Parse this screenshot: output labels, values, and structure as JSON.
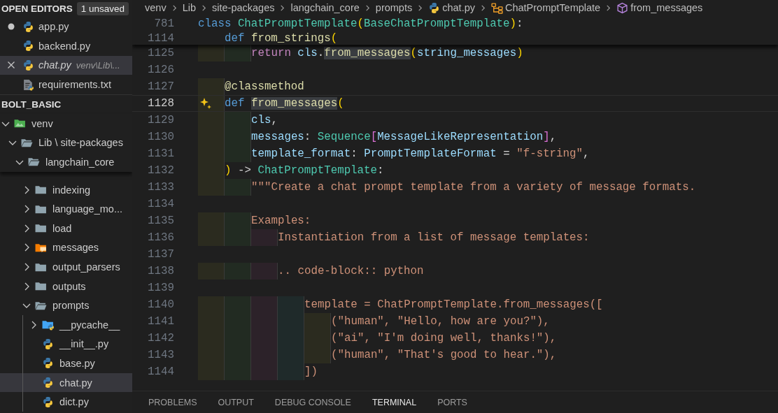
{
  "open_editors": {
    "title": "OPEN EDITORS",
    "badge": "1 unsaved",
    "items": [
      {
        "name": "app.py",
        "kind": "python",
        "dirty": true,
        "selected": false,
        "preview": false
      },
      {
        "name": "backend.py",
        "kind": "python",
        "dirty": false,
        "selected": false,
        "preview": false
      },
      {
        "name": "chat.py",
        "kind": "python",
        "dirty": false,
        "selected": true,
        "preview": true,
        "description": "venv\\Lib\\..."
      },
      {
        "name": "requirements.txt",
        "kind": "text",
        "dirty": false,
        "selected": false,
        "preview": false
      }
    ]
  },
  "explorer": {
    "title": "BOLT_BASIC",
    "tree": [
      {
        "name": "venv",
        "kind": "venv-folder",
        "expanded": true,
        "selected": false,
        "children": [
          {
            "name": "Lib \\ site-packages",
            "kind": "folder",
            "expanded": true,
            "selected": false,
            "children": [
              {
                "name": "langchain_core",
                "kind": "folder",
                "expanded": true,
                "selected": false,
                "children": [
                  {
                    "name": "indexing",
                    "kind": "folder",
                    "expanded": false,
                    "selected": false
                  },
                  {
                    "name": "language_mo...",
                    "kind": "folder",
                    "expanded": false,
                    "selected": false
                  },
                  {
                    "name": "load",
                    "kind": "folder",
                    "expanded": false,
                    "selected": false
                  },
                  {
                    "name": "messages",
                    "kind": "messages-folder",
                    "expanded": false,
                    "selected": false
                  },
                  {
                    "name": "output_parsers",
                    "kind": "folder",
                    "expanded": false,
                    "selected": false
                  },
                  {
                    "name": "outputs",
                    "kind": "folder",
                    "expanded": false,
                    "selected": false
                  },
                  {
                    "name": "prompts",
                    "kind": "folder",
                    "expanded": true,
                    "selected": false,
                    "children": [
                      {
                        "name": "__pycache__",
                        "kind": "pycache-folder",
                        "expanded": false,
                        "selected": false
                      },
                      {
                        "name": "__init__.py",
                        "kind": "python",
                        "selected": false
                      },
                      {
                        "name": "base.py",
                        "kind": "python",
                        "selected": false
                      },
                      {
                        "name": "chat.py",
                        "kind": "python",
                        "selected": true
                      },
                      {
                        "name": "dict.py",
                        "kind": "python",
                        "selected": false
                      }
                    ]
                  }
                ]
              }
            ]
          }
        ]
      }
    ]
  },
  "breadcrumb": [
    {
      "label": "venv",
      "kind": "folder"
    },
    {
      "label": "Lib",
      "kind": "folder"
    },
    {
      "label": "site-packages",
      "kind": "folder"
    },
    {
      "label": "langchain_core",
      "kind": "folder"
    },
    {
      "label": "prompts",
      "kind": "folder"
    },
    {
      "label": "chat.py",
      "kind": "python"
    },
    {
      "label": "ChatPromptTemplate",
      "kind": "class"
    },
    {
      "label": "from_messages",
      "kind": "method"
    }
  ],
  "sticky_lines": [
    {
      "num": "781",
      "tokens": [
        {
          "t": "class",
          "kind": "kw"
        },
        {
          "t": " ChatPromptTemplate",
          "kind": "type"
        },
        {
          "t": "(",
          "kind": "b1"
        },
        {
          "t": "BaseChatPromptTemplate",
          "kind": "type"
        },
        {
          "t": ")",
          "kind": "b1"
        },
        {
          "t": ":",
          "kind": "p"
        }
      ]
    },
    {
      "num": "1114",
      "tokens": [
        {
          "t": "    def",
          "kind": "kw"
        },
        {
          "t": " from_strings",
          "kind": "fn"
        },
        {
          "t": "(",
          "kind": "b1"
        }
      ]
    }
  ],
  "lines": [
    {
      "num": "1125",
      "current": false,
      "tokens": [
        {
          "t": "        return",
          "kind": "ctl",
          "highlighted": false
        },
        {
          "t": " cls",
          "kind": "var",
          "highlighted": false
        },
        {
          "t": ".",
          "kind": "p",
          "highlighted": false
        },
        {
          "t": "from_messages",
          "kind": "fn",
          "highlighted": true
        },
        {
          "t": "(",
          "kind": "b1",
          "highlighted": false
        },
        {
          "t": "string_messages",
          "kind": "var",
          "highlighted": false
        },
        {
          "t": ")",
          "kind": "b1",
          "highlighted": false
        }
      ]
    },
    {
      "num": "1126",
      "current": false
    },
    {
      "num": "1127",
      "current": false,
      "tokens": [
        {
          "t": "    @classmethod",
          "kind": "fn",
          "highlighted": false
        }
      ]
    },
    {
      "num": "1128",
      "current": true,
      "tokens": [
        {
          "t": "    def ",
          "kind": "kw",
          "highlighted": false
        },
        {
          "t": "from_messages",
          "kind": "fn",
          "highlighted": true
        },
        {
          "t": "(",
          "kind": "b1",
          "highlighted": false
        }
      ]
    },
    {
      "num": "1129",
      "current": false,
      "tokens": [
        {
          "t": "        cls",
          "kind": "var",
          "highlighted": false
        },
        {
          "t": ",",
          "kind": "p",
          "highlighted": false
        }
      ]
    },
    {
      "num": "1130",
      "current": false,
      "tokens": [
        {
          "t": "        messages",
          "kind": "var",
          "highlighted": false
        },
        {
          "t": ": ",
          "kind": "p",
          "highlighted": false
        },
        {
          "t": "Sequence",
          "kind": "type",
          "highlighted": false
        },
        {
          "t": "[",
          "kind": "b2",
          "highlighted": false
        },
        {
          "t": "MessageLikeRepresentation",
          "kind": "var",
          "highlighted": false
        },
        {
          "t": "]",
          "kind": "b2",
          "highlighted": false
        },
        {
          "t": ",",
          "kind": "p",
          "highlighted": false
        }
      ]
    },
    {
      "num": "1131",
      "current": false,
      "tokens": [
        {
          "t": "        template_format",
          "kind": "var",
          "highlighted": false
        },
        {
          "t": ": ",
          "kind": "p",
          "highlighted": false
        },
        {
          "t": "PromptTemplateFormat",
          "kind": "var",
          "highlighted": false
        },
        {
          "t": " = ",
          "kind": "p",
          "highlighted": false
        },
        {
          "t": "\"f-string\"",
          "kind": "str",
          "highlighted": false
        },
        {
          "t": ",",
          "kind": "p",
          "highlighted": false
        }
      ]
    },
    {
      "num": "1132",
      "current": false,
      "tokens": [
        {
          "t": "    )",
          "kind": "b1",
          "highlighted": false
        },
        {
          "t": " -> ",
          "kind": "p",
          "highlighted": false
        },
        {
          "t": "ChatPromptTemplate",
          "kind": "type",
          "highlighted": false
        },
        {
          "t": ":",
          "kind": "p",
          "highlighted": false
        }
      ]
    },
    {
      "num": "1133",
      "current": false,
      "tokens": [
        {
          "t": "        \"\"\"Create a chat prompt template from a variety of message formats.",
          "kind": "str",
          "highlighted": false
        }
      ]
    },
    {
      "num": "1134",
      "current": false
    },
    {
      "num": "1135",
      "current": false,
      "tokens": [
        {
          "t": "        Examples:",
          "kind": "str",
          "highlighted": false
        }
      ]
    },
    {
      "num": "1136",
      "current": false,
      "tokens": [
        {
          "t": "            Instantiation from a list of message templates:",
          "kind": "str",
          "highlighted": false
        }
      ]
    },
    {
      "num": "1137",
      "current": false
    },
    {
      "num": "1138",
      "current": false,
      "tokens": [
        {
          "t": "            .. code-block:: python",
          "kind": "str",
          "highlighted": false
        }
      ]
    },
    {
      "num": "1139",
      "current": false
    },
    {
      "num": "1140",
      "current": false,
      "tokens": [
        {
          "t": "                template = ChatPromptTemplate.from_messages([",
          "kind": "str",
          "highlighted": false
        }
      ]
    },
    {
      "num": "1141",
      "current": false,
      "tokens": [
        {
          "t": "                    (\"human\", \"Hello, how are you?\"),",
          "kind": "str",
          "highlighted": false
        }
      ]
    },
    {
      "num": "1142",
      "current": false,
      "tokens": [
        {
          "t": "                    (\"ai\", \"I'm doing well, thanks!\"),",
          "kind": "str",
          "highlighted": false
        }
      ]
    },
    {
      "num": "1143",
      "current": false,
      "tokens": [
        {
          "t": "                    (\"human\", \"That's good to hear.\"),",
          "kind": "str",
          "highlighted": false
        }
      ]
    },
    {
      "num": "1144",
      "current": false,
      "tokens": [
        {
          "t": "                ])",
          "kind": "str",
          "highlighted": false
        }
      ]
    }
  ],
  "panel_tabs": [
    {
      "label": "PROBLEMS",
      "selected": false
    },
    {
      "label": "OUTPUT",
      "selected": false
    },
    {
      "label": "DEBUG CONSOLE",
      "selected": false
    },
    {
      "label": "TERMINAL",
      "selected": true
    },
    {
      "label": "PORTS",
      "selected": false
    }
  ]
}
